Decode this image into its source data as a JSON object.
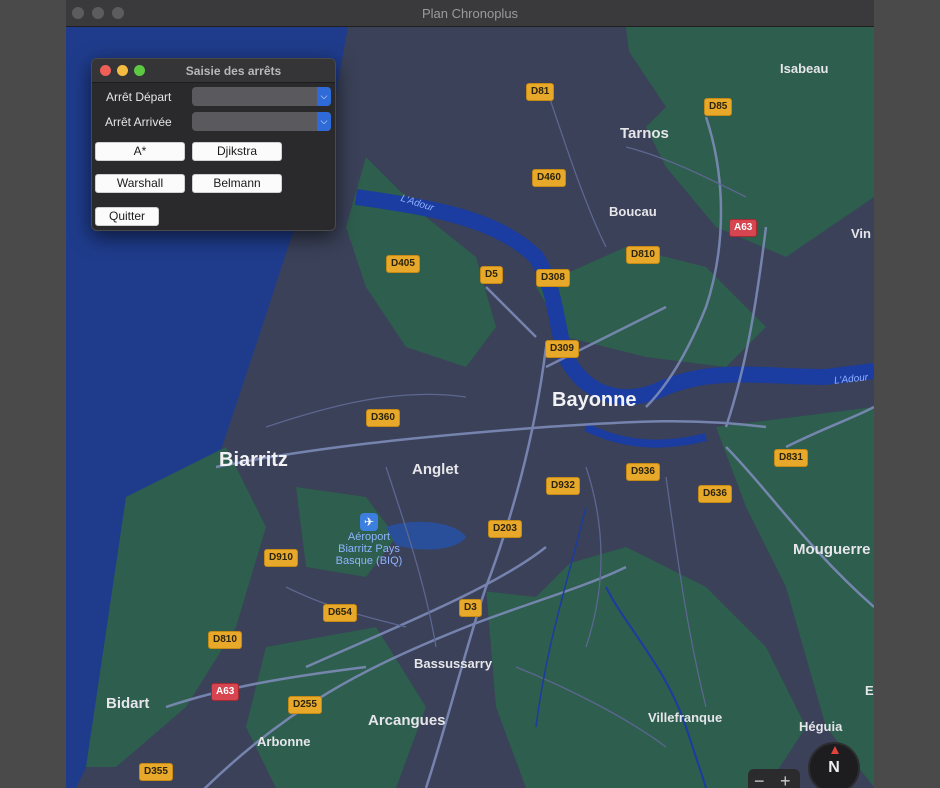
{
  "app_title": "Plan Chronoplus",
  "dialog": {
    "title": "Saisie des arrêts",
    "depart_label": "Arrêt Départ",
    "arrivee_label": "Arrêt Arrivée",
    "buttons": {
      "astar": "A*",
      "dijkstra": "Djikstra",
      "warshall": "Warshall",
      "belmann": "Belmann",
      "quitter": "Quitter"
    }
  },
  "map": {
    "colors": {
      "water": "#1f3c8c",
      "land": "#3a4158",
      "green": "#2d5e4e",
      "road": "#7d8bb8",
      "river": "#1b3ca0"
    },
    "places": {
      "biarritz": "Biarritz",
      "bayonne": "Bayonne",
      "anglet": "Anglet",
      "tarnos": "Tarnos",
      "boucau": "Boucau",
      "isabeau": "Isabeau",
      "mouguerre": "Mouguerre",
      "bassussarry": "Bassussarry",
      "arcangues": "Arcangues",
      "arbonne": "Arbonne",
      "bidart": "Bidart",
      "villefranque": "Villefranque",
      "heguia": "Héguia",
      "vin": "Vin",
      "e": "E"
    },
    "river_labels": {
      "adour_1": "L'Adour",
      "adour_2": "L'Adour"
    },
    "airport": {
      "icon": "airplane-icon",
      "label_line1": "Aéroport",
      "label_line2": "Biarritz Pays",
      "label_line3": "Basque (BIQ)"
    },
    "road_labels": {
      "d81": "D81",
      "d85": "D85",
      "d460": "D460",
      "a63_n": "A63",
      "d405": "D405",
      "d5": "D5",
      "d308": "D308",
      "d810_n": "D810",
      "d309": "D309",
      "d360": "D360",
      "d936": "D936",
      "d831": "D831",
      "d636": "D636",
      "d932": "D932",
      "d203": "D203",
      "d910": "D910",
      "d654": "D654",
      "d3": "D3",
      "d810_s": "D810",
      "a63_s": "A63",
      "d255": "D255",
      "d355": "D355"
    },
    "compass": "N",
    "zoom_out": "−",
    "zoom_in": "+"
  }
}
